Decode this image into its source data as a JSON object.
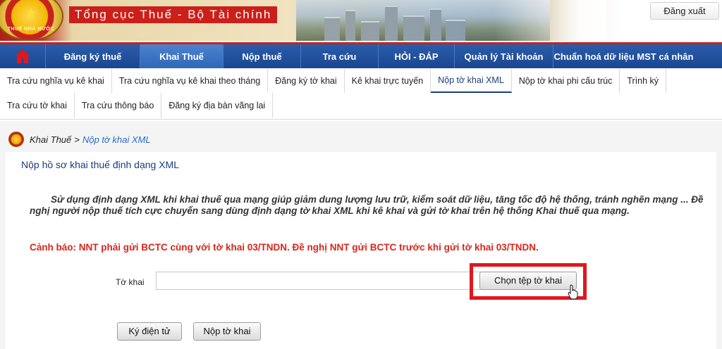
{
  "header": {
    "site_title": "Tổng cục Thuế - Bộ Tài chính",
    "logout_label": "Đăng xuất",
    "emblem_icon": "national-emblem-icon",
    "colors": {
      "brand_red": "#cc1f1a",
      "nav_blue": "#1b4690"
    }
  },
  "nav": {
    "home_icon": "home-icon",
    "items": [
      {
        "label": "Đăng ký thuế",
        "active": false
      },
      {
        "label": "Khai Thuế",
        "active": true
      },
      {
        "label": "Nộp thuế",
        "active": false
      },
      {
        "label": "Tra cứu",
        "active": false
      },
      {
        "label": "HỎI - ĐÁP",
        "active": false
      },
      {
        "label": "Quản lý Tài khoản",
        "active": false
      },
      {
        "label": "Chuẩn hoá dữ liệu MST cá nhân",
        "active": false
      }
    ]
  },
  "subtabs": {
    "row1": [
      {
        "label": "Tra cứu nghĩa vụ kê khai",
        "active": false
      },
      {
        "label": "Tra cứu nghĩa vụ kê khai theo tháng",
        "active": false
      },
      {
        "label": "Đăng ký tờ khai",
        "active": false
      },
      {
        "label": "Kê khai trực tuyến",
        "active": false
      },
      {
        "label": "Nộp tờ khai XML",
        "active": true
      },
      {
        "label": "Nộp tờ khai phi cấu trúc",
        "active": false
      },
      {
        "label": "Trình ký",
        "active": false
      }
    ],
    "row2": [
      {
        "label": "Tra cứu tờ khai",
        "active": false
      },
      {
        "label": "Tra cứu thông báo",
        "active": false
      },
      {
        "label": "Đăng ký địa bàn vãng lai",
        "active": false
      }
    ]
  },
  "breadcrumb": {
    "parent": "Khai Thuế",
    "separator": ">",
    "current": "Nộp tờ khai XML"
  },
  "main": {
    "title": "Nộp hồ sơ khai thuế định dạng XML",
    "intro": "Sử dụng định dạng XML khi khai thuế qua mạng giúp giảm dung lượng lưu trữ, kiểm soát dữ liệu, tăng tốc độ hệ thống, tránh nghẽn mạng ... Đề nghị người nộp thuế tích cực chuyển sang dùng định dạng tờ khai XML khi kê khai và gửi tờ khai trên hệ thống Khai thuế qua mạng.",
    "warning": "Cảnh báo: NNT phải gửi BCTC cùng với tờ khai 03/TNDN. Đề nghị NNT gửi BCTC trước khi gửi tờ khai 03/TNDN.",
    "file_label": "Tờ khai",
    "file_value": "",
    "choose_file_label": "Chọn tệp tờ khai",
    "sign_label": "Ký điện tử",
    "submit_label": "Nộp tờ khai",
    "warning_color": "#d8261c",
    "highlight_color": "#e0171d"
  }
}
